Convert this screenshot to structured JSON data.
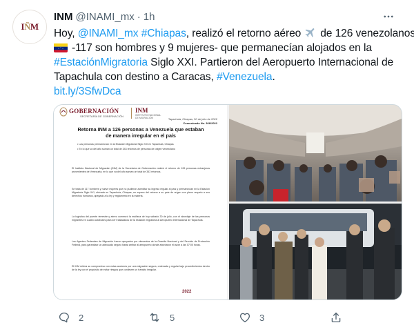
{
  "tweet": {
    "author": {
      "display_name": "INM",
      "handle": "@INAMI_mx",
      "time": "1h",
      "avatar_text": "INM"
    },
    "text": {
      "l1_a": "Hoy, ",
      "l1_mention": "@INAMI_mx",
      "l1_hashtag": "#Chiapas",
      "l1_b": ", realizó el retorno aéreo",
      "l1_c": "de 126 venezolanos",
      "l2": "-117 son hombres y 9 mujeres- que permanecían alojados en la",
      "l3_hashtag": "#EstaciónMigratoria",
      "l3_b": " Siglo XXI. Partieron del Aeropuerto Internacional de",
      "l4_a": "Tapachula con destino a Caracas, ",
      "l4_hashtag": "#Venezuela",
      "l4_b": ".",
      "link": "bit.ly/3SfwDca"
    },
    "media": {
      "document": {
        "header_left": "GOBERNACIÓN",
        "header_left_sub": "SECRETARÍA DE GOBERNACIÓN",
        "header_right": "INM",
        "header_right_sub": "INSTITUTO NACIONAL DE MIGRACIÓN",
        "date": "Tapachula, Chiapas, 30 de julio de 2022",
        "number": "Comunicado No. 366/2022",
        "title": "Retorna INM a 126 personas a Venezuela que estaban de manera irregular en el país",
        "bullet1": "Las personas permanecían en la Estación Migratoria Siglo XXI en Tapachula, Chiapas",
        "bullet2": "En lo que va del año suman un total de 343 retornos de personas de origen venezolano",
        "para1": "El Instituto Nacional de Migración (INM) de la Secretaría de Gobernación realizó el retorno de 126 personas extranjeras provenientes de Venezuela, en lo que va del año suman un total de 343 retornos.",
        "para2": "Se trata de 117 hombres y nueve mujeres que no pudieron acreditar su ingreso regular al país y permanecían en la Estación Migratoria Siglo XXI, ubicada en Tapachula, Chiapas, en espera del retorno a su país de origen con pleno respeto a sus derechos humanos, apegado a la ley y reglamento en la materia.",
        "para3": "La logística del puente terrestre y aéreo comenzó la mañana de hoy sábado 30 de julio, con el abordaje de las personas migrantes en cuatro autobuses para ser trasladados de la estación migratoria al Aeropuerto Internacional de Tapachula.",
        "para4": "Los Agentes Federales de Migración fueron apoyados por elementos de la Guardia Nacional y del Servicio de Protección Federal, para garantizar un adecuado seguro hasta arribar al aeropuerto donde abordaron el avión a las 07:00 horas.",
        "para5": "El INM reitera su compromiso con estas acciones por una migración segura, ordenada y regular bajo procedimientos dentro de la ley con el propósito de evitar riesgos que conlleven un tránsito irregular.",
        "footer": "2022"
      }
    },
    "actions": {
      "reply_count": "2",
      "retweet_count": "5",
      "like_count": "3"
    }
  },
  "colors": {
    "link": "#1d9bf0",
    "text": "#0f1419",
    "muted": "#536471",
    "brand": "#7a1c2c"
  }
}
